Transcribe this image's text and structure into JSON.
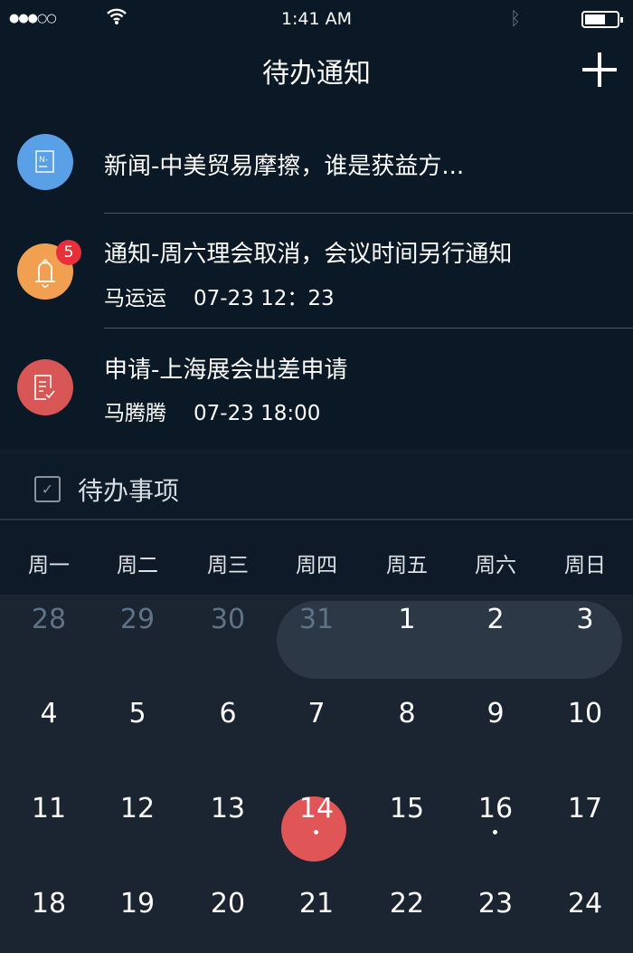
{
  "status": {
    "signal": "●●●○○",
    "time": "1:41 AM",
    "battery_level": 0.6
  },
  "header": {
    "title": "待办通知",
    "add_icon": "plus-icon"
  },
  "notifications": [
    {
      "icon": "news-icon",
      "color": "#5aa0e6",
      "title": "新闻-中美贸易摩擦，谁是获益方...",
      "author": "",
      "time": ""
    },
    {
      "icon": "bell-icon",
      "color": "#f0a050",
      "badge": "5",
      "title": "通知-周六理会取消，会议时间另行通知",
      "author": "马运运",
      "time": "07-23 12：23"
    },
    {
      "icon": "document-check-icon",
      "color": "#d95656",
      "title": "申请-上海展会出差申请",
      "author": "马腾腾",
      "time": "07-23 18:00"
    }
  ],
  "todo": {
    "label": "待办事项"
  },
  "calendar": {
    "weekdays": [
      "周一",
      "周二",
      "周三",
      "周四",
      "周五",
      "周六",
      "周日"
    ],
    "weeks": [
      [
        "28",
        "29",
        "30",
        "31",
        "1",
        "2",
        "3"
      ],
      [
        "4",
        "5",
        "6",
        "7",
        "8",
        "9",
        "10"
      ],
      [
        "11",
        "12",
        "13",
        "14",
        "15",
        "16",
        "17"
      ],
      [
        "18",
        "19",
        "20",
        "21",
        "22",
        "23",
        "24"
      ]
    ],
    "today": "14",
    "event_days": [
      "14",
      "16"
    ],
    "accent": "#e05555"
  }
}
